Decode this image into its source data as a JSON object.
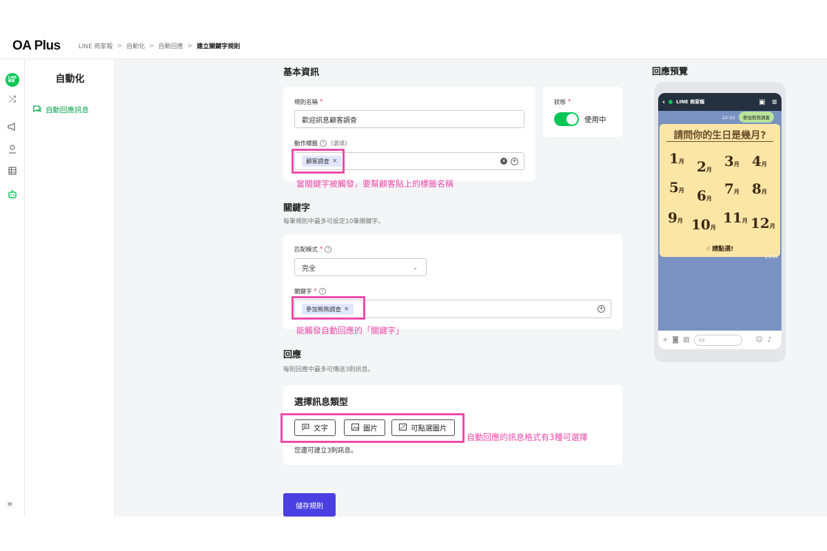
{
  "app": {
    "logo": "OA Plus"
  },
  "breadcrumb": [
    "LINE 商家報",
    "自動化",
    "自動回應",
    "建立關鍵字規則"
  ],
  "breadcrumb_sep": ">",
  "sidebar": {
    "title": "自動化",
    "items": [
      {
        "label": "自動回應訊息"
      }
    ]
  },
  "rail": {
    "line_badge": "LINE\n商家報",
    "expand": "»"
  },
  "basic": {
    "title": "基本資訊",
    "rule_name_label": "規則名稱",
    "rule_name_value": "歡迎訊息顧客調查",
    "action_tag_label": "動作標籤",
    "action_tag_optional": "(選填)",
    "action_tag": "顧客調查",
    "status_label": "狀態",
    "status_value": "使用中",
    "annotation": "當關鍵字被觸發，要幫顧客貼上的標籤名稱"
  },
  "keyword": {
    "title": "關鍵字",
    "desc": "每筆規則中最多可設定10筆關鍵字。",
    "match_label": "匹配模式",
    "match_value": "完全",
    "keyword_label": "關鍵字",
    "keyword_tag": "參加熊熊調查",
    "annotation": "能觸發自動回應的「關鍵字」"
  },
  "response": {
    "title": "回應",
    "desc": "每則回應中最多可傳送3則訊息。",
    "select_title": "選擇訊息類型",
    "types": [
      "文字",
      "圖片",
      "可點選圖片"
    ],
    "remaining": "您還可建立3則訊息。",
    "annotation": "自動回應的訊息格式有3種可選擇"
  },
  "save_button": "儲存規則",
  "preview": {
    "title": "回應預覽",
    "chat_name": "LINE 商家報",
    "time_sent": "22:52",
    "keyword_bubble": "參加熊熊調查",
    "rich_title": "請問你的生日是幾月?",
    "months": [
      "1",
      "2",
      "3",
      "4",
      "5",
      "6",
      "7",
      "8",
      "9",
      "10",
      "11",
      "12"
    ],
    "month_unit": "月",
    "tap_text": "請點選!",
    "time_reply": "23:03",
    "input_placeholder": "Aa"
  },
  "colors": {
    "line_green": "#06c755",
    "annotation_pink": "#ec4aa9",
    "primary_button": "#4a3fe0"
  }
}
